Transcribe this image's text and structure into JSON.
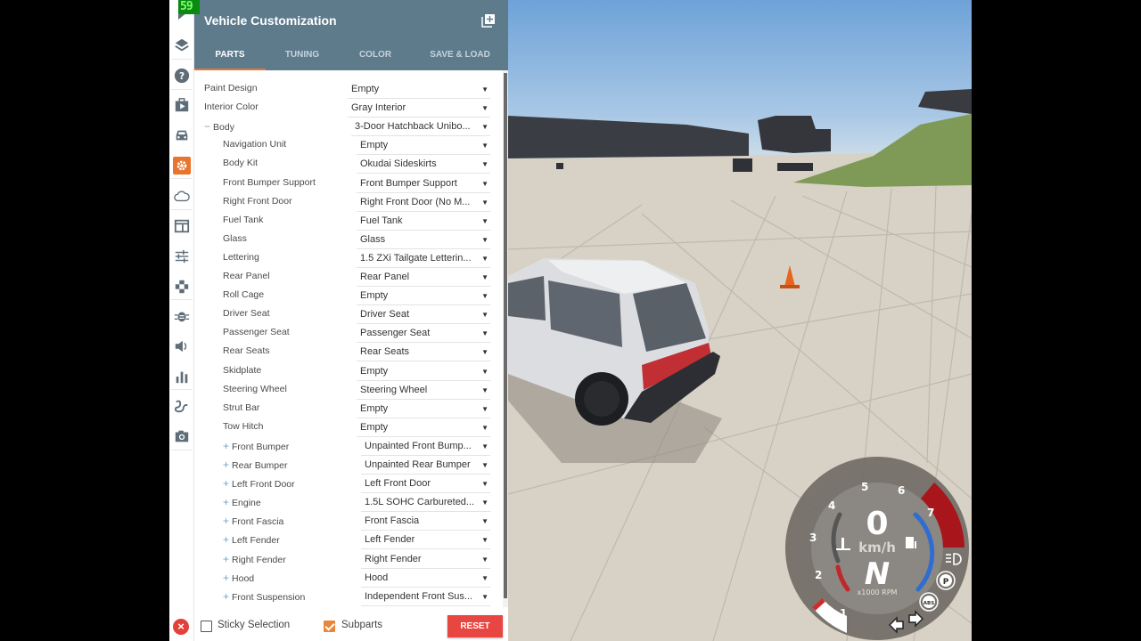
{
  "fps": "59",
  "panel": {
    "title": "Vehicle Customization",
    "add_icon": "add-window-icon",
    "tabs": [
      {
        "label": "PARTS",
        "active": true
      },
      {
        "label": "TUNING",
        "active": false
      },
      {
        "label": "COLOR",
        "active": false
      },
      {
        "label": "SAVE & LOAD",
        "active": false
      }
    ],
    "parts": [
      {
        "label": "Paint Design",
        "value": "Empty",
        "level": 0,
        "expander": ""
      },
      {
        "label": "Interior Color",
        "value": "Gray Interior",
        "level": 0,
        "expander": ""
      },
      {
        "label": "Body",
        "value": "3-Door Hatchback Unibo...",
        "level": 0,
        "expander": "−"
      },
      {
        "label": "Navigation Unit",
        "value": "Empty",
        "level": 1,
        "expander": ""
      },
      {
        "label": "Body Kit",
        "value": "Okudai Sideskirts",
        "level": 1,
        "expander": ""
      },
      {
        "label": "Front Bumper Support",
        "value": "Front Bumper Support",
        "level": 1,
        "expander": ""
      },
      {
        "label": "Right Front Door",
        "value": "Right Front Door (No M...",
        "level": 1,
        "expander": ""
      },
      {
        "label": "Fuel Tank",
        "value": "Fuel Tank",
        "level": 1,
        "expander": ""
      },
      {
        "label": "Glass",
        "value": "Glass",
        "level": 1,
        "expander": ""
      },
      {
        "label": "Lettering",
        "value": "1.5 ZXi Tailgate Letterin...",
        "level": 1,
        "expander": ""
      },
      {
        "label": "Rear Panel",
        "value": "Rear Panel",
        "level": 1,
        "expander": ""
      },
      {
        "label": "Roll Cage",
        "value": "Empty",
        "level": 1,
        "expander": ""
      },
      {
        "label": "Driver Seat",
        "value": "Driver Seat",
        "level": 1,
        "expander": ""
      },
      {
        "label": "Passenger Seat",
        "value": "Passenger Seat",
        "level": 1,
        "expander": ""
      },
      {
        "label": "Rear Seats",
        "value": "Rear Seats",
        "level": 1,
        "expander": ""
      },
      {
        "label": "Skidplate",
        "value": "Empty",
        "level": 1,
        "expander": ""
      },
      {
        "label": "Steering Wheel",
        "value": "Steering Wheel",
        "level": 1,
        "expander": ""
      },
      {
        "label": "Strut Bar",
        "value": "Empty",
        "level": 1,
        "expander": ""
      },
      {
        "label": "Tow Hitch",
        "value": "Empty",
        "level": 1,
        "expander": ""
      },
      {
        "label": "Front Bumper",
        "value": "Unpainted Front Bump...",
        "level": 1,
        "expander": "+"
      },
      {
        "label": "Rear Bumper",
        "value": "Unpainted Rear Bumper",
        "level": 1,
        "expander": "+"
      },
      {
        "label": "Left Front Door",
        "value": "Left Front Door",
        "level": 1,
        "expander": "+"
      },
      {
        "label": "Engine",
        "value": "1.5L SOHC Carbureted...",
        "level": 1,
        "expander": "+"
      },
      {
        "label": "Front Fascia",
        "value": "Front Fascia",
        "level": 1,
        "expander": "+"
      },
      {
        "label": "Left Fender",
        "value": "Left Fender",
        "level": 1,
        "expander": "+"
      },
      {
        "label": "Right Fender",
        "value": "Right Fender",
        "level": 1,
        "expander": "+"
      },
      {
        "label": "Hood",
        "value": "Hood",
        "level": 1,
        "expander": "+"
      },
      {
        "label": "Front Suspension",
        "value": "Independent Front Sus...",
        "level": 1,
        "expander": "+"
      }
    ],
    "footer": {
      "sticky_selection": {
        "label": "Sticky Selection",
        "checked": false
      },
      "subparts": {
        "label": "Subparts",
        "checked": true
      },
      "reset_label": "RESET"
    }
  },
  "rail": {
    "icons": [
      "layers-icon",
      "help-icon",
      "scenario-icon",
      "vehicle-icon",
      "vehicle-config-icon",
      "cloud-icon",
      "window-icon",
      "settings-sliders-icon",
      "controls-icon",
      "debug-bug-icon",
      "audio-icon",
      "performance-chart-icon",
      "route-icon",
      "camera-icon"
    ],
    "active_icon": "vehicle-config-icon"
  },
  "gauge": {
    "speed": "0",
    "speed_unit": "km/h",
    "gear": "N",
    "rpm_unit": "x1000 RPM",
    "rpm_ticks": [
      "1",
      "2",
      "3",
      "4",
      "5",
      "6",
      "7"
    ],
    "rpm_value": 0.8,
    "indicators": [
      "headlight-icon",
      "parking-brake-icon",
      "abs-icon",
      "turn-left-icon",
      "turn-right-icon",
      "temperature-icon",
      "fuel-icon"
    ],
    "colors": {
      "redline": "#a8161b",
      "fuel": "#2f6dd1",
      "temp": "#c1262b"
    }
  },
  "colors": {
    "header_bg": "#5e7b8c",
    "accent": "#e8742d",
    "reset": "#e84640"
  }
}
